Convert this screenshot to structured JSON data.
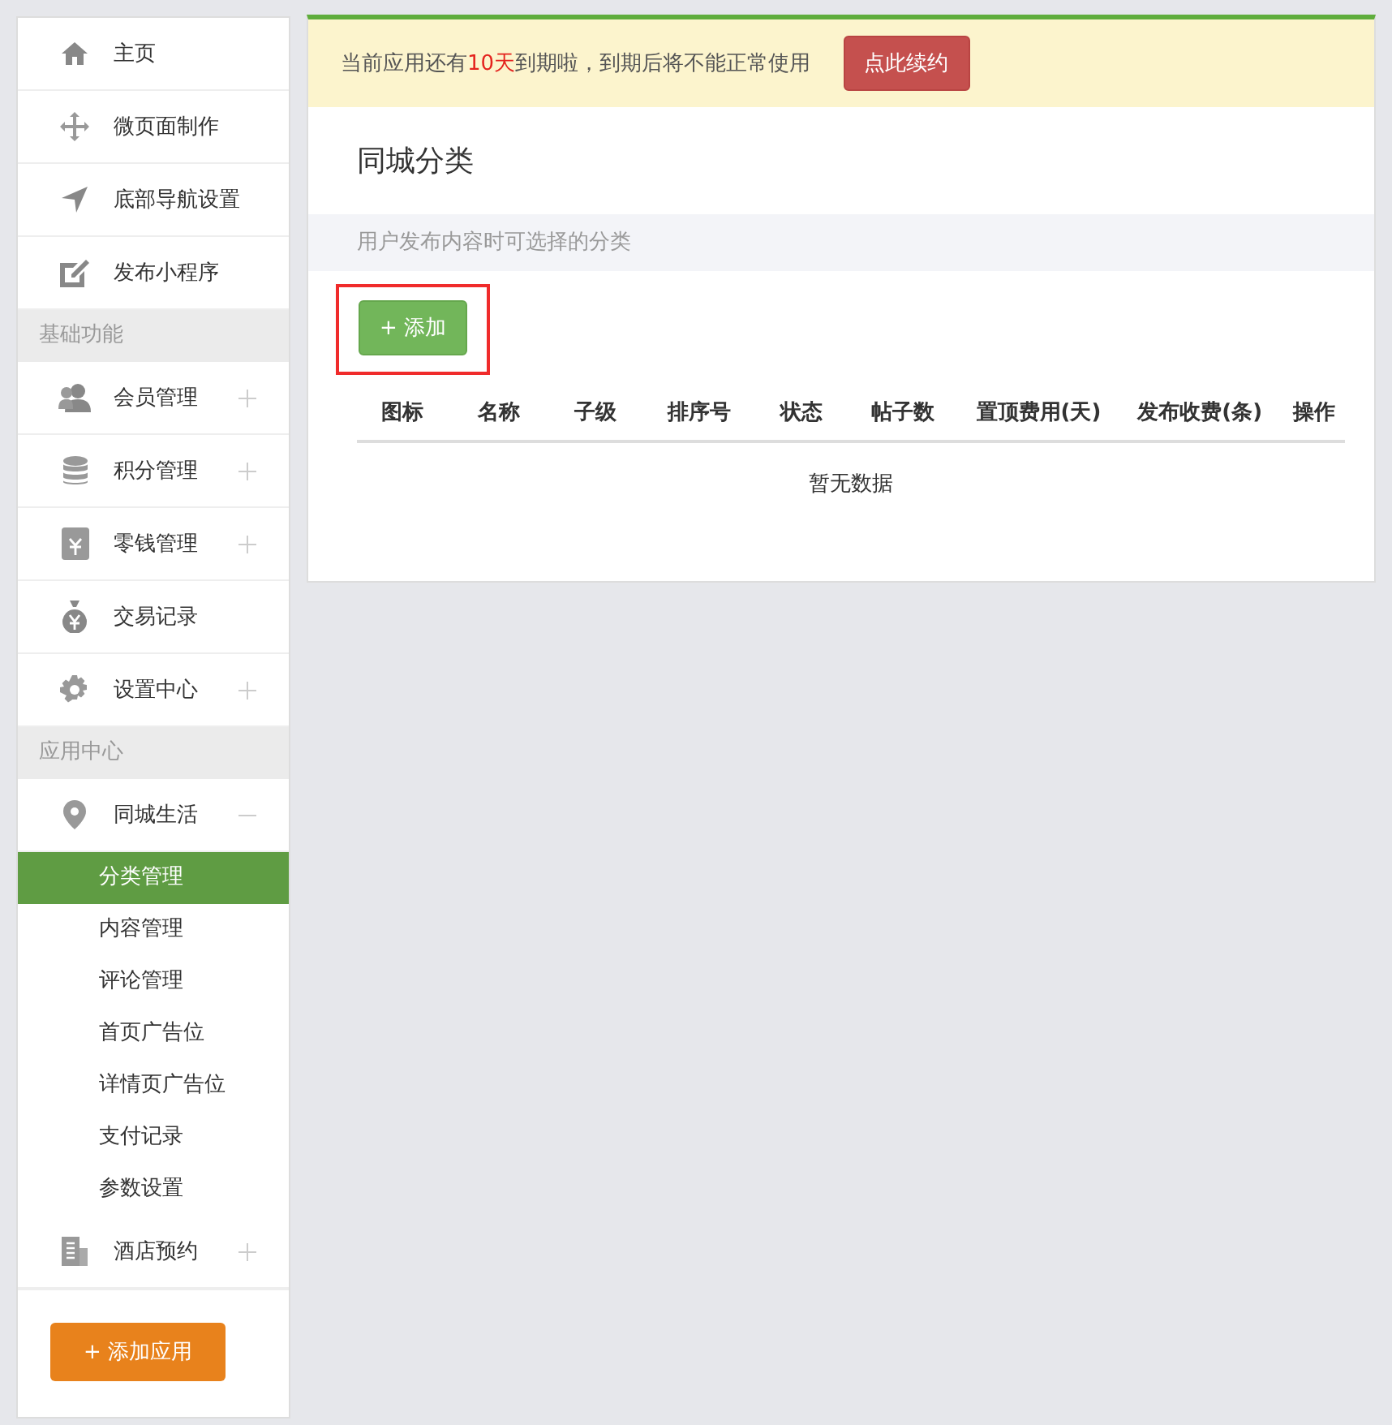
{
  "sidebar": {
    "menu": [
      {
        "kind": "item",
        "label": "主页"
      },
      {
        "kind": "item",
        "label": "微页面制作"
      },
      {
        "kind": "item",
        "label": "底部导航设置"
      },
      {
        "kind": "item",
        "label": "发布小程序"
      },
      {
        "kind": "section",
        "label": "基础功能"
      },
      {
        "kind": "item",
        "label": "会员管理",
        "expanded": false
      },
      {
        "kind": "item",
        "label": "积分管理",
        "expanded": false
      },
      {
        "kind": "item",
        "label": "零钱管理",
        "expanded": false
      },
      {
        "kind": "item",
        "label": "交易记录"
      },
      {
        "kind": "item",
        "label": "设置中心",
        "expanded": false
      },
      {
        "kind": "section",
        "label": "应用中心"
      },
      {
        "kind": "item",
        "label": "同城生活",
        "expanded": true,
        "children": [
          {
            "label": "分类管理",
            "selected": true
          },
          {
            "label": "内容管理",
            "selected": false
          },
          {
            "label": "评论管理",
            "selected": false
          },
          {
            "label": "首页广告位",
            "selected": false
          },
          {
            "label": "详情页广告位",
            "selected": false
          },
          {
            "label": "支付记录",
            "selected": false
          },
          {
            "label": "参数设置",
            "selected": false
          }
        ]
      },
      {
        "kind": "item",
        "label": "酒店预约",
        "expanded": false
      }
    ],
    "add_app_button": "+ 添加应用"
  },
  "notice": {
    "text_before": "当前应用还有",
    "highlight": "10天",
    "text_after": "到期啦，到期后将不能正常使用",
    "button": "点此续约"
  },
  "page": {
    "title": "同城分类",
    "subtitle": "用户发布内容时可选择的分类",
    "add_button": {
      "label": "+ 添加",
      "highlighted": true
    }
  },
  "table": {
    "columns": [
      "图标",
      "名称",
      "子级",
      "排序号",
      "状态",
      "帖子数",
      "置顶费用(天)",
      "发布收费(条)",
      "操作"
    ],
    "empty_text": "暂无数据"
  }
}
